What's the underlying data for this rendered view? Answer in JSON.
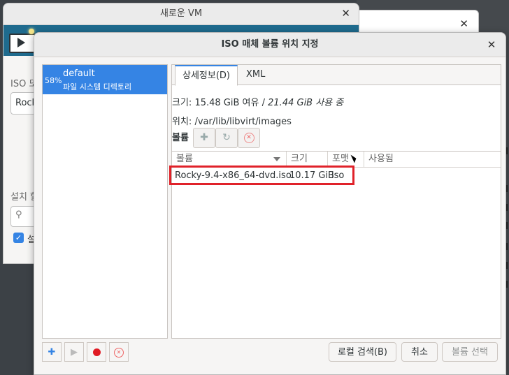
{
  "background_windows": {
    "vm_title": "새로운 VM",
    "vm_label_iso": "ISO 또",
    "vm_field_value": "Rock",
    "vm_label_install": "설치 할",
    "vm_search_icon": "search-icon",
    "vm_checkbox_label": "설"
  },
  "dialog": {
    "title": "ISO 매체 볼륨 위치 지정",
    "pool": {
      "percent": "58%",
      "name": "default",
      "type": "파일 시스템 디렉토리"
    },
    "tabs": [
      "상세정보(D)",
      "XML"
    ],
    "details": {
      "size_label": "크기:",
      "free": "15.48 GiB 여유",
      "separator": "/",
      "used": "21.44 GiB 사용 중",
      "location_label": "위치:",
      "location": "/var/lib/libvirt/images"
    },
    "volumes_label": "볼륨",
    "volume_columns": [
      "볼륨",
      "크기",
      "포맷",
      "사용됨"
    ],
    "volumes": [
      {
        "name": "Rocky-9.4-x86_64-dvd.iso",
        "size": "10.17 GiB",
        "format": "iso",
        "used_by": ""
      }
    ],
    "buttons": {
      "browse_local": "로컬 검색(B)",
      "cancel": "취소",
      "choose_volume": "볼륨 선택"
    },
    "colors": {
      "accent": "#3584e4",
      "highlight_border": "#e0222a",
      "record": "#e01b24"
    }
  }
}
